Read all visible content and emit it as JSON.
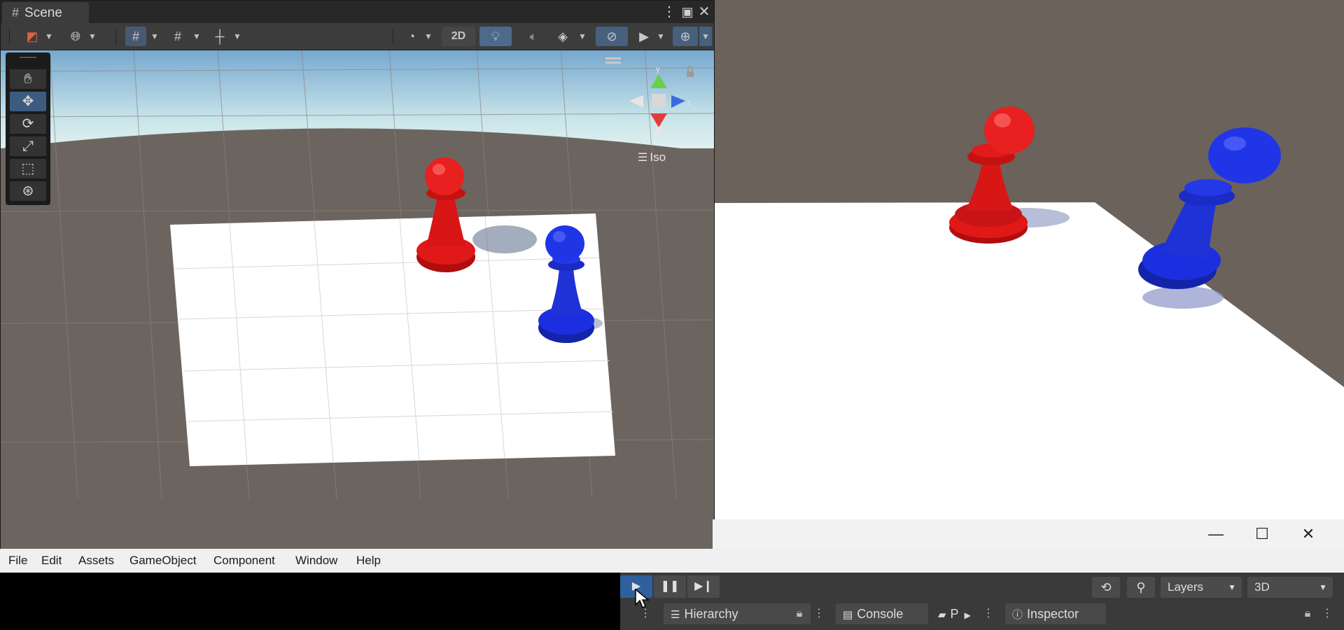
{
  "scene_window": {
    "tab_title": "Scene",
    "more_icon": "vertical-dots-icon",
    "maximize_icon": "maximize-icon",
    "close_icon": "close-icon",
    "toolbar": {
      "view_2d_label": "2D"
    },
    "orientation_gizmo": {
      "axis_y": "y",
      "axis_z": "z",
      "projection_label": "Iso"
    }
  },
  "os_window": {
    "minimize_glyph": "—",
    "maximize_glyph": "☐",
    "close_glyph": "✕"
  },
  "menu_bar": {
    "items": [
      "File",
      "Edit",
      "Assets",
      "GameObject",
      "Component",
      "Window",
      "Help"
    ]
  },
  "toolbar": {
    "layers_label": "Layers",
    "layout_label": "3D"
  },
  "panels": {
    "hierarchy_label": "Hierarchy",
    "console_label": "Console",
    "project_label": "P",
    "inspector_label": "Inspector"
  },
  "colors": {
    "red_pawn": "#e01818",
    "blue_pawn": "#1c2fe0",
    "accent": "#3d5b80"
  }
}
